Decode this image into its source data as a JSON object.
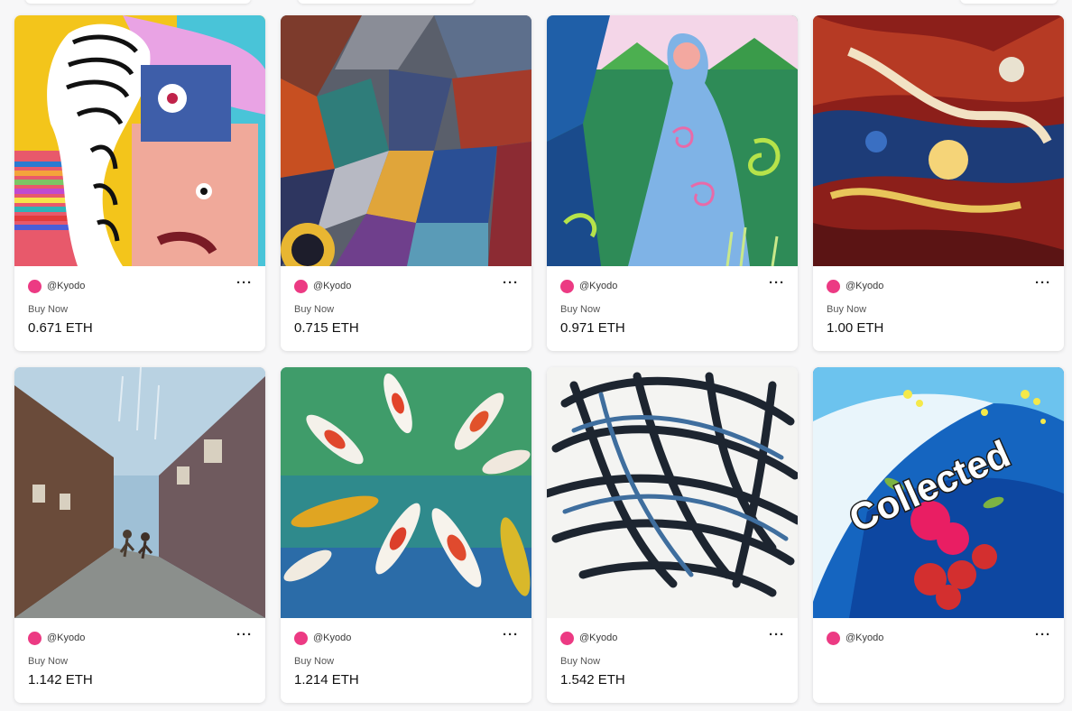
{
  "cards": [
    {
      "creator": "@Kyodo",
      "status": "Buy Now",
      "price": "0.671 ETH",
      "art": "abstract-faces-artwork"
    },
    {
      "creator": "@Kyodo",
      "status": "Buy Now",
      "price": "0.715 ETH",
      "art": "cubist-shapes-artwork"
    },
    {
      "creator": "@Kyodo",
      "status": "Buy Now",
      "price": "0.971 ETH",
      "art": "stained-glass-figure-artwork"
    },
    {
      "creator": "@Kyodo",
      "status": "Buy Now",
      "price": "1.00 ETH",
      "art": "abstract-splash-artwork"
    },
    {
      "creator": "@Kyodo",
      "status": "Buy Now",
      "price": "1.142 ETH",
      "art": "rainy-street-artwork"
    },
    {
      "creator": "@Kyodo",
      "status": "Buy Now",
      "price": "1.214 ETH",
      "art": "koi-pond-artwork"
    },
    {
      "creator": "@Kyodo",
      "status": "Buy Now",
      "price": "1.542 ETH",
      "art": "woven-nest-artwork"
    },
    {
      "creator": "@Kyodo",
      "status": "",
      "price": "",
      "art": "orchid-wave-artwork",
      "overlay": "Collected"
    }
  ],
  "menu_icon": "more-horizontal-icon",
  "colors": {
    "avatar": "#ec3a83",
    "background": "#f7f7f8",
    "card": "#ffffff"
  }
}
